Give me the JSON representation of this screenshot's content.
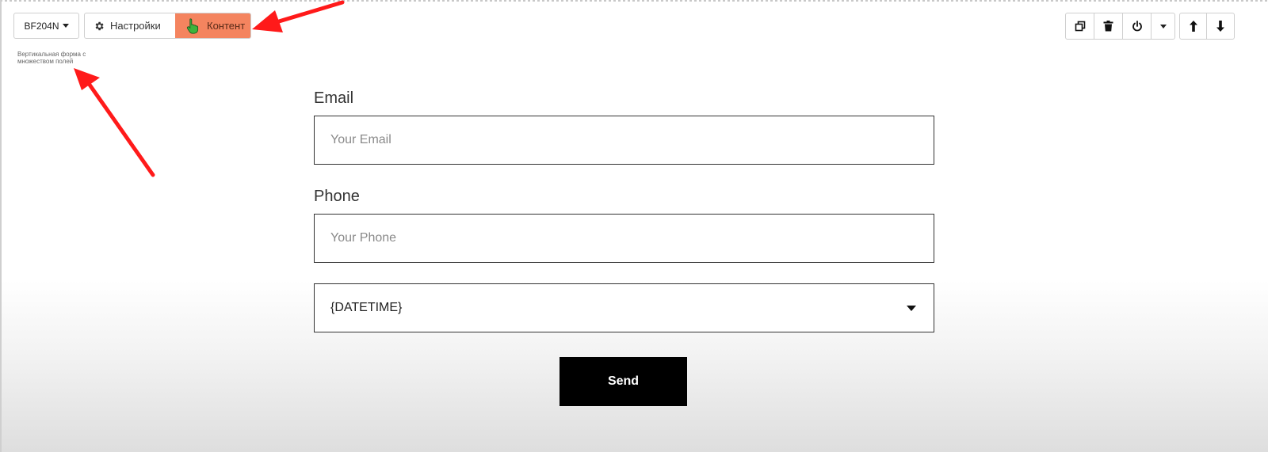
{
  "toolbar": {
    "block_id": "BF204N",
    "tabs": [
      {
        "label": "Настройки",
        "icon": "gear-icon"
      },
      {
        "label": "Контент",
        "icon": "pointer-hand-icon",
        "active": true,
        "accent": "#f4845f"
      }
    ],
    "block_description": "Вертикальная форма с множеством полей",
    "actions": [
      "copy-icon",
      "trash-icon",
      "power-icon",
      "chevron-down-icon",
      "arrow-up-icon",
      "arrow-down-icon"
    ]
  },
  "form": {
    "email": {
      "label": "Email",
      "placeholder": "Your Email"
    },
    "phone": {
      "label": "Phone",
      "placeholder": "Your Phone"
    },
    "datetime": {
      "value": "{DATETIME}"
    },
    "submit_label": "Send"
  },
  "colors": {
    "annotation_arrow": "#ff1a1a",
    "active_tab": "#f4845f",
    "button_bg": "#000000"
  }
}
